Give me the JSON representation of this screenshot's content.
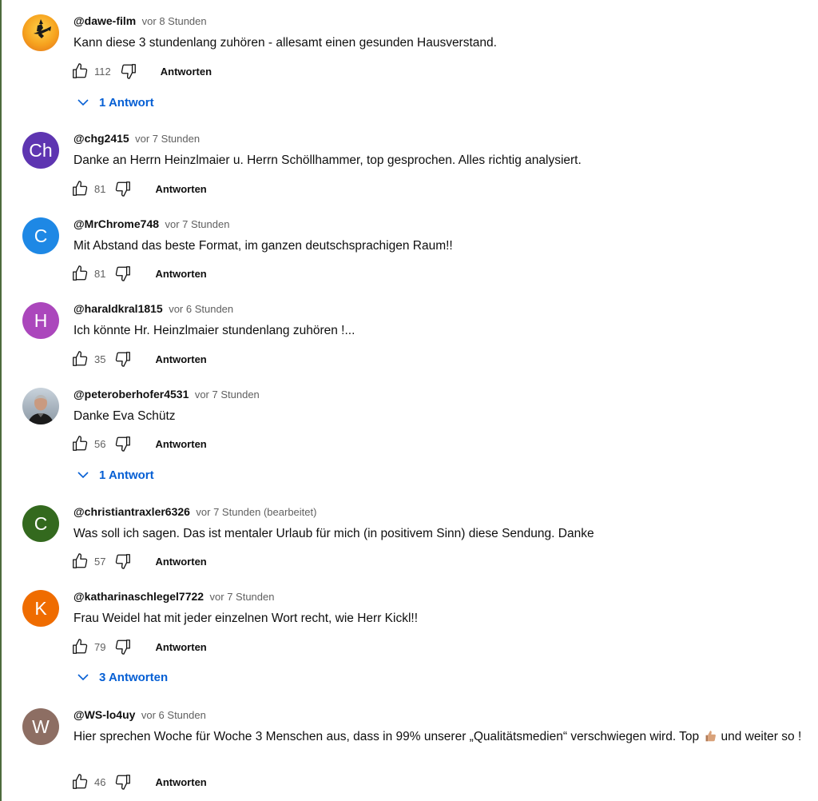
{
  "ui": {
    "reply_label": "Antworten",
    "accent": "#065fd4"
  },
  "comments": [
    {
      "author": "@dawe-film",
      "time": "vor 8 Stunden",
      "text": "Kann diese 3 stundenlang zuhören - allesamt einen gesunden Hausverstand.",
      "likes": "112",
      "avatar_letter": "",
      "avatar_color": "#f5a623",
      "replies_label": "1 Antwort"
    },
    {
      "author": "@chg2415",
      "time": "vor 7 Stunden",
      "text": "Danke an Herrn Heinzlmaier u. Herrn Schöllhammer, top gesprochen. Alles richtig analysiert.",
      "likes": "81",
      "avatar_letter": "Ch",
      "avatar_color": "#5e35b1"
    },
    {
      "author": "@MrChrome748",
      "time": "vor 7 Stunden",
      "text": "Mit Abstand das beste Format, im ganzen deutschsprachigen Raum!!",
      "likes": "81",
      "avatar_letter": "C",
      "avatar_color": "#1e88e5"
    },
    {
      "author": "@haraldkral1815",
      "time": "vor 6 Stunden",
      "text": "Ich könnte Hr. Heinzlmaier stundenlang zuhören !...",
      "likes": "35",
      "avatar_letter": "H",
      "avatar_color": "#ab47bc"
    },
    {
      "author": "@peteroberhofer4531",
      "time": "vor 7 Stunden",
      "text": "Danke Eva Schütz",
      "likes": "56",
      "avatar_letter": "",
      "avatar_color": "#9aa7b3",
      "replies_label": "1 Antwort"
    },
    {
      "author": "@christiantraxler6326",
      "time": "vor 7 Stunden (bearbeitet)",
      "text": "Was soll ich sagen. Das ist mentaler Urlaub für mich (in positivem Sinn)  diese Sendung. Danke",
      "likes": "57",
      "avatar_letter": "C",
      "avatar_color": "#33691e"
    },
    {
      "author": "@katharinaschlegel7722",
      "time": "vor 7 Stunden",
      "text": "Frau Weidel hat mit jeder einzelnen Wort recht, wie Herr Kickl!!",
      "likes": "79",
      "avatar_letter": "K",
      "avatar_color": "#ef6c00",
      "replies_label": "3 Antworten"
    },
    {
      "author": "@WS-lo4uy",
      "time": "vor 6 Stunden",
      "text": "Hier sprechen Woche für Woche 3 Menschen aus, dass in 99% unserer „Qualitätsmedien“ verschwiegen wird. Top",
      "text_after_emoji": "und weiter so !",
      "emoji": "thumbs-up-emoji",
      "likes": "46",
      "avatar_letter": "W",
      "avatar_color": "#8d6e63"
    }
  ]
}
